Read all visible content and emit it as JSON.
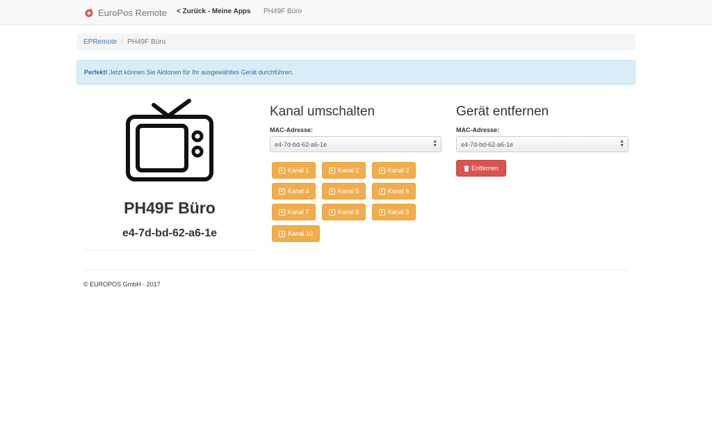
{
  "navbar": {
    "brand": "EuroPos Remote",
    "back_link": "< Zurück - Meine Apps",
    "device_link": "PH49F Büro",
    "logo_color": "#d9534f"
  },
  "breadcrumb": {
    "items": [
      "EPRemote",
      "PH49F Büro"
    ],
    "separator": "/"
  },
  "alert": {
    "strong": "Perfekt!",
    "message": " Jetzt können Sie Aktionen für Ihr ausgewähltes Gerät durchführen."
  },
  "device": {
    "icon": "tv-icon",
    "name": "PH49F Büro",
    "mac": "e4-7d-bd-62-a6-1e"
  },
  "channel_section": {
    "title": "Kanal umschalten",
    "mac_label": "MAC-Adresse:",
    "mac_selected": "e4-7d-bd-62-a6-1e",
    "buttons": [
      "Kanal 1",
      "Kanal 2",
      "Kanal 3",
      "Kanal 4",
      "Kanal 5",
      "Kanal 6",
      "Kanal 7",
      "Kanal 8",
      "Kanal 9",
      "Kanal 10"
    ],
    "button_color": "#f0ad4e"
  },
  "remove_section": {
    "title": "Gerät entfernen",
    "mac_label": "MAC-Adresse:",
    "mac_selected": "e4-7d-bd-62-a6-1e",
    "button_label": "Entfernen",
    "button_color": "#d9534f"
  },
  "footer": {
    "text": "© EUROPOS GmbH - 2017"
  }
}
